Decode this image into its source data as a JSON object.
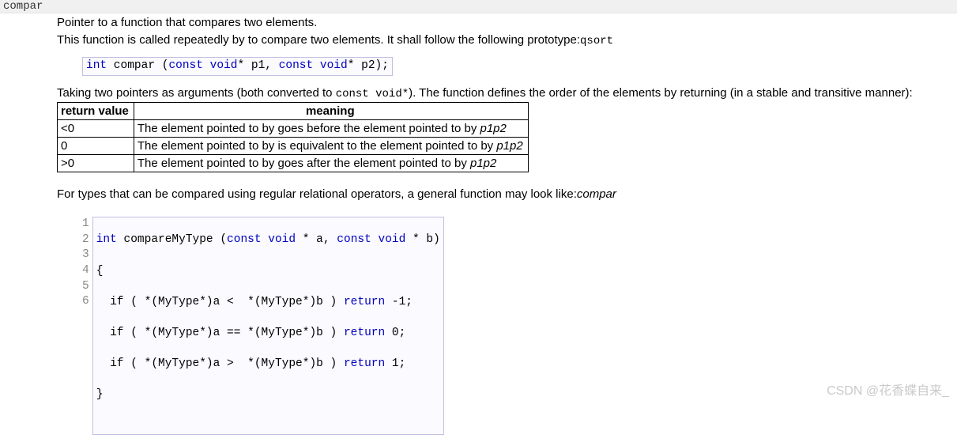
{
  "section_title": "compar",
  "intro_line1": "Pointer to a function that compares two elements.",
  "intro_line2_pre": "This function is called repeatedly by to compare two elements. It shall follow the following prototype:",
  "intro_line2_suffix": "qsort",
  "proto_prefix_kw": "int",
  "proto_mid": " compar (",
  "proto_kw_const1": "const",
  "proto_kw_void1": "void",
  "proto_ptr1": "* p1, ",
  "proto_kw_const2": "const",
  "proto_kw_void2": "void",
  "proto_tail": "* p2);",
  "bridge_pre": "Taking two pointers as arguments (both converted to ",
  "bridge_mono": "const void*",
  "bridge_post": "). The function defines the order of the elements by returning (in a stable and transitive manner):",
  "table": {
    "head_retval": "return value",
    "head_meaning": "meaning",
    "rows": [
      {
        "ret": "<0",
        "body": "The element pointed to by goes before the element pointed to by ",
        "ital": "p1p2"
      },
      {
        "ret": "0",
        "body": "The element pointed to by is equivalent to the element pointed to by ",
        "ital": "p1p2"
      },
      {
        "ret": ">0",
        "body": "The element pointed to by goes after the element pointed to by ",
        "ital": "p1p2"
      }
    ]
  },
  "closing_pre": "For types that can be compared using regular relational operators, a general function may look like:",
  "closing_em": "compar",
  "code": {
    "l1_kw_int": "int",
    "l1_mid": " compareMyType (",
    "l1_kw_const1": "const",
    "l1_kw_void1": "void",
    "l1_a": " * a, ",
    "l1_kw_const2": "const",
    "l1_kw_void2": "void",
    "l1_b": " * b)",
    "l2": "{",
    "l3_pre": "  if ( *(MyType*)a <  *(MyType*)b ) ",
    "l3_kw": "return",
    "l3_post": " -1;",
    "l4_pre": "  if ( *(MyType*)a == *(MyType*)b ) ",
    "l4_kw": "return",
    "l4_post": " 0;",
    "l5_pre": "  if ( *(MyType*)a >  *(MyType*)b ) ",
    "l5_kw": "return",
    "l5_post": " 1;",
    "l6": "}"
  },
  "gutter": {
    "n1": "1",
    "n2": "2",
    "n3": "3",
    "n4": "4",
    "n5": "5",
    "n6": "6"
  },
  "watermark": "CSDN @花香蝶自来_"
}
